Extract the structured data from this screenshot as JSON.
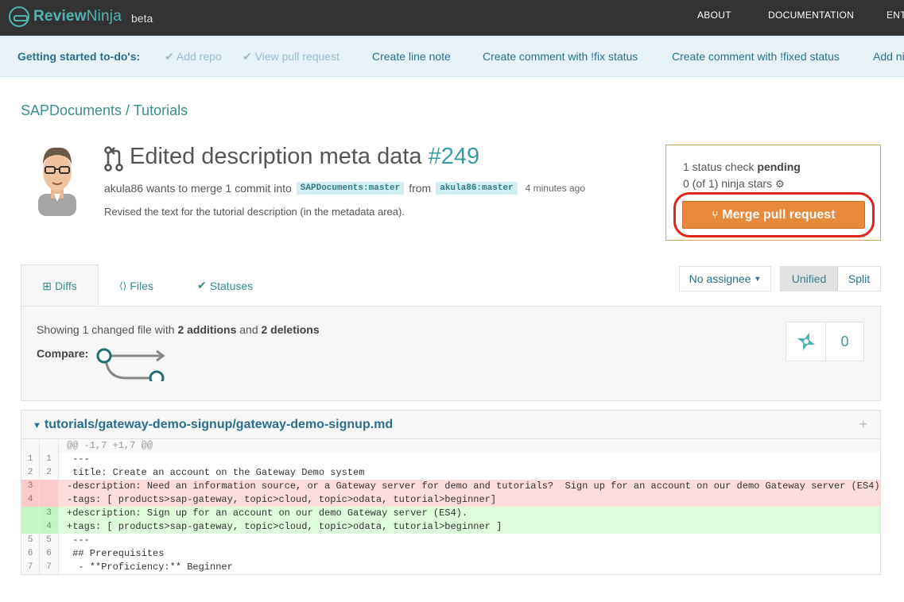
{
  "topbar": {
    "brand_bold": "Review",
    "brand_thin": "Ninja",
    "beta": "beta",
    "nav": [
      "ABOUT",
      "DOCUMENTATION",
      "ENT"
    ]
  },
  "getting_started": {
    "title": "Getting started to-do's:",
    "done": [
      "Add repo",
      "View pull request"
    ],
    "todo": [
      "Create line note",
      "Create comment with !fix status",
      "Create comment with !fixed status",
      "Add ni"
    ]
  },
  "breadcrumb": "SAPDocuments / Tutorials",
  "pull_request": {
    "title": "Edited description meta data",
    "number": "#249",
    "author": "akula86",
    "action": "wants to merge 1 commit into",
    "base_branch": "SAPDocuments:master",
    "from": "from",
    "head_branch": "akula86:master",
    "time": "4 minutes ago",
    "description": "Revised the text for the tutorial description (in the metadata area)."
  },
  "status": {
    "line1_prefix": "1 status check",
    "line1_state": "pending",
    "line2": "0 (of 1) ninja stars",
    "merge_label": "Merge pull request"
  },
  "tabs": [
    {
      "label": "Diffs",
      "icon": "diff-icon"
    },
    {
      "label": "Files",
      "icon": "file-code-icon"
    },
    {
      "label": "Statuses",
      "icon": "check-icon"
    }
  ],
  "assignee_label": "No assignee",
  "view_toggle": {
    "unified": "Unified",
    "split": "Split"
  },
  "summary": {
    "showing_prefix": "Showing 1 changed file with",
    "additions": "2 additions",
    "and": "and",
    "deletions": "2 deletions",
    "compare_label": "Compare:",
    "star_count": "0"
  },
  "file": {
    "path": "tutorials/gateway-demo-signup/gateway-demo-signup.md",
    "lines": [
      {
        "type": "hunk",
        "old": "",
        "new": "",
        "text": "@@ -1,7 +1,7 @@"
      },
      {
        "type": "ctx",
        "old": "1",
        "new": "1",
        "text": " ---"
      },
      {
        "type": "ctx",
        "old": "2",
        "new": "2",
        "text": " title: Create an account on the Gateway Demo system"
      },
      {
        "type": "del",
        "old": "3",
        "new": "",
        "text": "-description: Need an information source, or a Gateway server for demo and tutorials?  Sign up for an account on our demo Gateway server (ES4)."
      },
      {
        "type": "del",
        "old": "4",
        "new": "",
        "text": "-tags: [ products>sap-gateway, topic>cloud, topic>odata, tutorial>beginner]"
      },
      {
        "type": "add",
        "old": "",
        "new": "3",
        "text": "+description: Sign up for an account on our demo Gateway server (ES4)."
      },
      {
        "type": "add",
        "old": "",
        "new": "4",
        "text": "+tags: [ products>sap-gateway, topic>cloud, topic>odata, tutorial>beginner ]"
      },
      {
        "type": "ctx",
        "old": "5",
        "new": "5",
        "text": " ---"
      },
      {
        "type": "ctx",
        "old": "6",
        "new": "6",
        "text": " ## Prerequisites"
      },
      {
        "type": "ctx",
        "old": "7",
        "new": "7",
        "text": "  - **Proficiency:** Beginner"
      }
    ]
  },
  "colors": {
    "teal": "#3a9d9d",
    "merge_orange": "#e8883a",
    "highlight_red": "#e0231b"
  }
}
